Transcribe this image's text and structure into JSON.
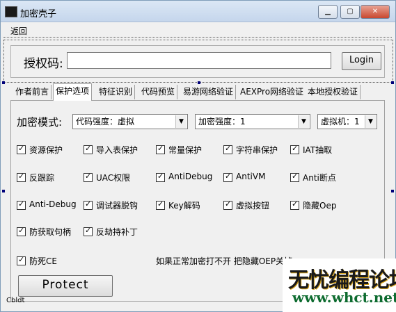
{
  "window": {
    "title": "加密壳子"
  },
  "menu": {
    "back": "返回"
  },
  "auth": {
    "label": "授权码:",
    "value": "",
    "login": "Login"
  },
  "tabs": [
    {
      "label": "作者前言",
      "active": false
    },
    {
      "label": "保护选项",
      "active": true
    },
    {
      "label": "特征识别",
      "active": false
    },
    {
      "label": "代码预览",
      "active": false
    },
    {
      "label": "易游网络验证",
      "active": false
    },
    {
      "label": "AEXPro网络验证",
      "active": false
    },
    {
      "label": "本地授权验证",
      "active": false
    }
  ],
  "options": {
    "mode_label": "加密模式:",
    "code_strength": "代码强度：虚拟",
    "encrypt_strength": "加密强度：1",
    "vm": "虚拟机：1"
  },
  "checkboxes": [
    {
      "label": "资源保护",
      "checked": true
    },
    {
      "label": "导入表保护",
      "checked": true
    },
    {
      "label": "常量保护",
      "checked": true
    },
    {
      "label": "字符串保护",
      "checked": true
    },
    {
      "label": "IAT抽取",
      "checked": true
    },
    {
      "label": "反跟踪",
      "checked": true
    },
    {
      "label": "UAC权限",
      "checked": true
    },
    {
      "label": "AntiDebug",
      "checked": true
    },
    {
      "label": "AntiVM",
      "checked": true
    },
    {
      "label": "Anti断点",
      "checked": true
    },
    {
      "label": "Anti-Debug",
      "checked": true
    },
    {
      "label": "调试器脱钩",
      "checked": true
    },
    {
      "label": "Key解码",
      "checked": true
    },
    {
      "label": "虚拟按钮",
      "checked": true
    },
    {
      "label": "隐藏Oep",
      "checked": true
    },
    {
      "label": "防获取句柄",
      "checked": true
    },
    {
      "label": "反劫持补丁",
      "checked": true
    },
    {
      "label": "防死CE",
      "checked": true
    }
  ],
  "note": "如果正常加密打不开 把隐藏OEP关掉",
  "protect_button": "Protect",
  "status": "Cbldt",
  "watermark": {
    "line1": "无忧编程论坛",
    "line2": "www.whct.net"
  }
}
